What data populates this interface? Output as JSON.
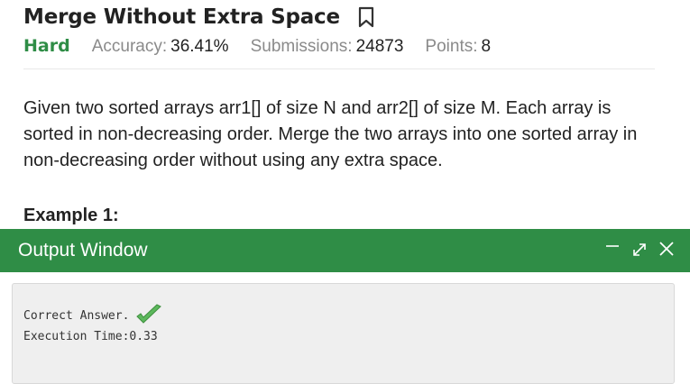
{
  "problem": {
    "title": "Merge Without Extra Space",
    "difficulty": "Hard",
    "accuracy_label": "Accuracy:",
    "accuracy_value": "36.41%",
    "submissions_label": "Submissions:",
    "submissions_value": "24873",
    "points_label": "Points:",
    "points_value": "8",
    "description": "Given two sorted arrays arr1[] of size N and arr2[] of size M. Each array is sorted in non-decreasing order. Merge the two arrays into one sorted array in non-decreasing order without using any extra space.",
    "example_heading": "Example 1:",
    "bookmark_icon": "bookmark-icon"
  },
  "output_window": {
    "title": "Output Window",
    "controls": [
      "minimize-icon",
      "expand-icon",
      "close-icon"
    ],
    "result_text": "Correct Answer.",
    "time_text": "Execution Time:0.33",
    "check_color": "#5cb85c"
  },
  "colors": {
    "brand_green": "#2f8d46",
    "output_bg": "#efefef"
  }
}
